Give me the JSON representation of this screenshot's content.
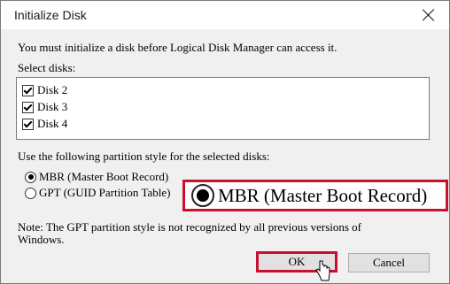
{
  "dialog": {
    "title": "Initialize Disk",
    "message": "You must initialize a disk before Logical Disk Manager can access it.",
    "select_label": "Select disks:",
    "disks": [
      "Disk 2",
      "Disk 3",
      "Disk 4"
    ],
    "partition_label": "Use the following partition style for the selected disks:",
    "options": [
      {
        "label": "MBR (Master Boot Record)",
        "selected": true
      },
      {
        "label": "GPT (GUID Partition Table)",
        "selected": false
      }
    ],
    "zoom_label": "MBR (Master Boot Record)",
    "note_line1": "Note: The GPT partition style is not recognized by all previous versions of",
    "note_line2": "Windows.",
    "ok_label": "OK",
    "cancel_label": "Cancel"
  },
  "colors": {
    "highlight": "#c8102e"
  }
}
